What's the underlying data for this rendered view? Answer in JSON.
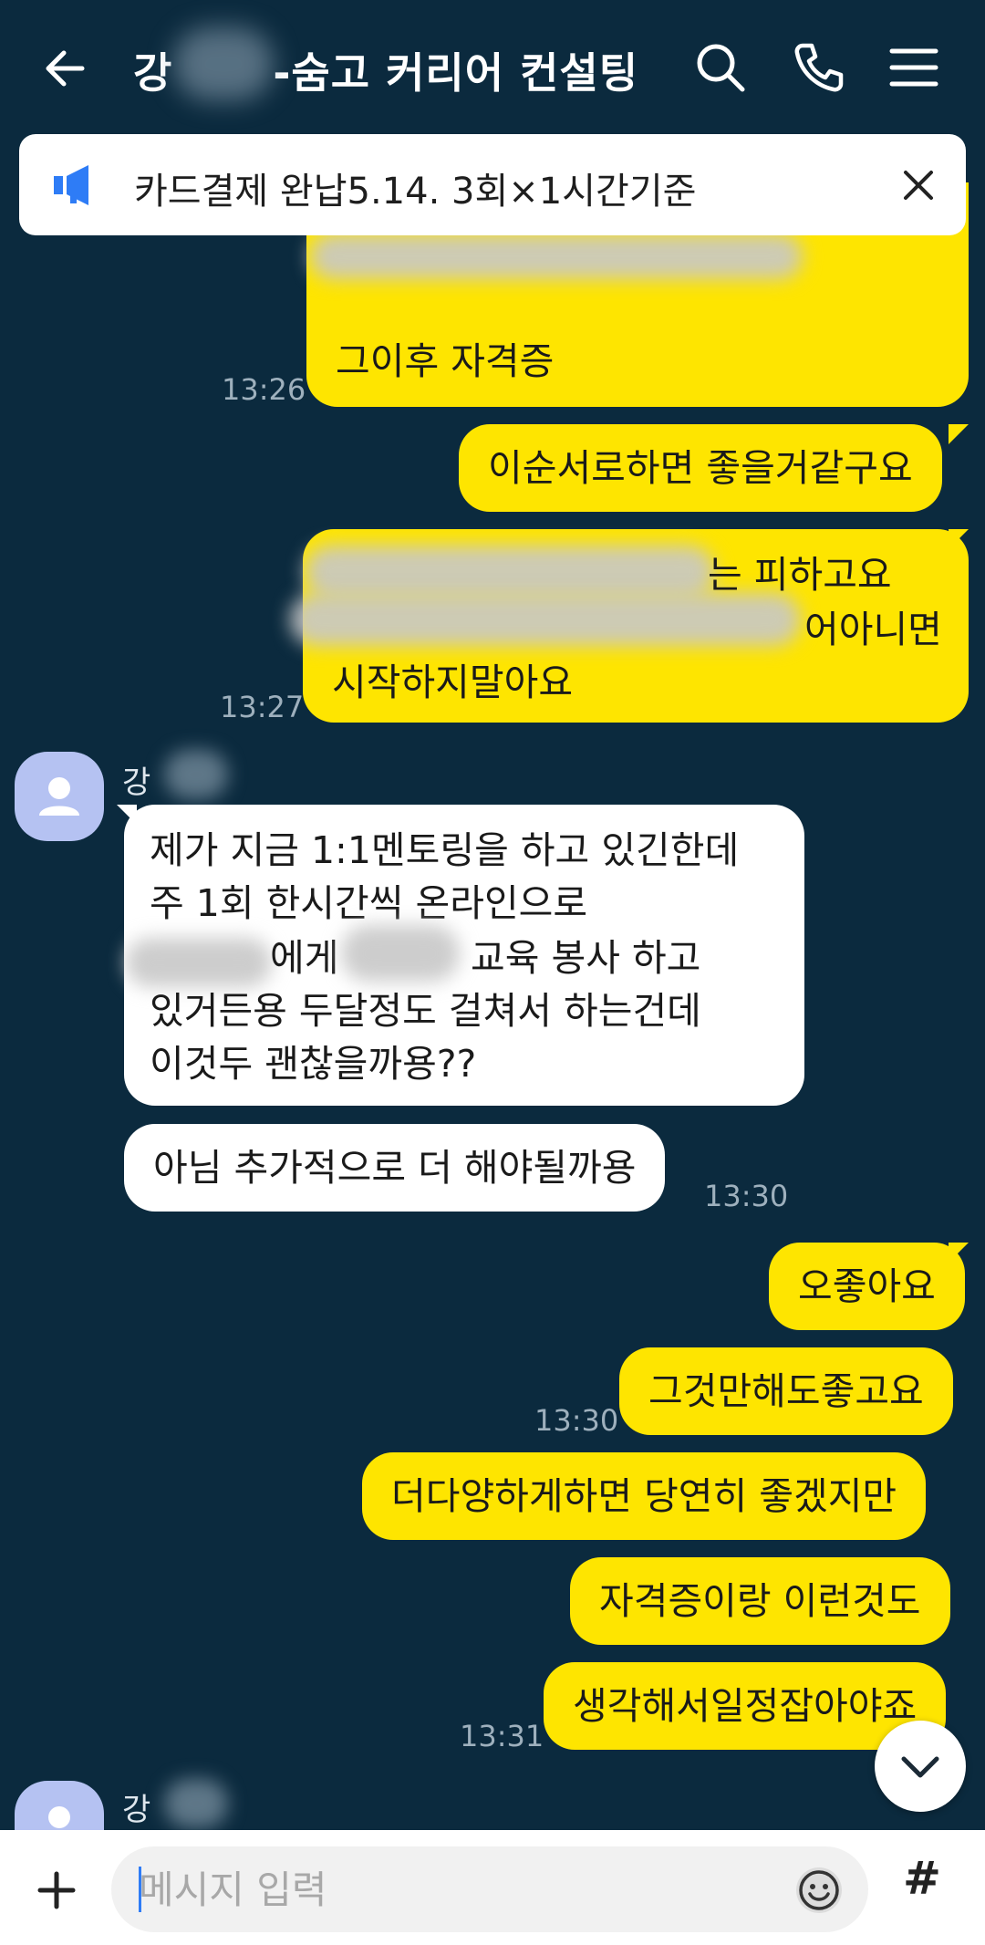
{
  "header": {
    "title_prefix": "강",
    "title_suffix": "-숨고 커리어 컨설팅"
  },
  "notice": {
    "text": "카드결제 완납5.14.  3회×1시간기준"
  },
  "messages": {
    "m1": {
      "text": "그이후 자격증",
      "time": "13:26"
    },
    "m2": {
      "text": "이순서로하면 좋을거같구요"
    },
    "m3": {
      "line1": "는 피하고요",
      "line2": "어아니면",
      "line3": "시작하지말아요",
      "time": "13:27"
    },
    "sender1": {
      "name": "강"
    },
    "m4": {
      "line1": "제가 지금 1:1멘토링을 하고 있긴한데",
      "line2": "주 1회 한시간씩 온라인으로",
      "line3a": "에게",
      "line3b": "교육 봉사 하고",
      "line4": "있거든용 두달정도 걸쳐서 하는건데",
      "line5": "이것두 괜찮을까용??"
    },
    "m5": {
      "text": "아님 추가적으로 더 해야될까용",
      "time": "13:30"
    },
    "m6": {
      "text": "오좋아요"
    },
    "m7": {
      "text": "그것만해도좋고요",
      "time": "13:30"
    },
    "m8": {
      "text": "더다양하게하면 당연히 좋겠지만"
    },
    "m9": {
      "text": "자격증이랑 이런것도"
    },
    "m10": {
      "text": "생각해서일정잡아야죠",
      "time": "13:31"
    },
    "sender2": {
      "name": "강"
    }
  },
  "input": {
    "placeholder": "메시지 입력",
    "hash_label": "#"
  },
  "colors": {
    "background": "#0b2a3e",
    "my_bubble": "#fee500",
    "their_bubble": "#ffffff",
    "notice_icon": "#2e7cf6"
  }
}
